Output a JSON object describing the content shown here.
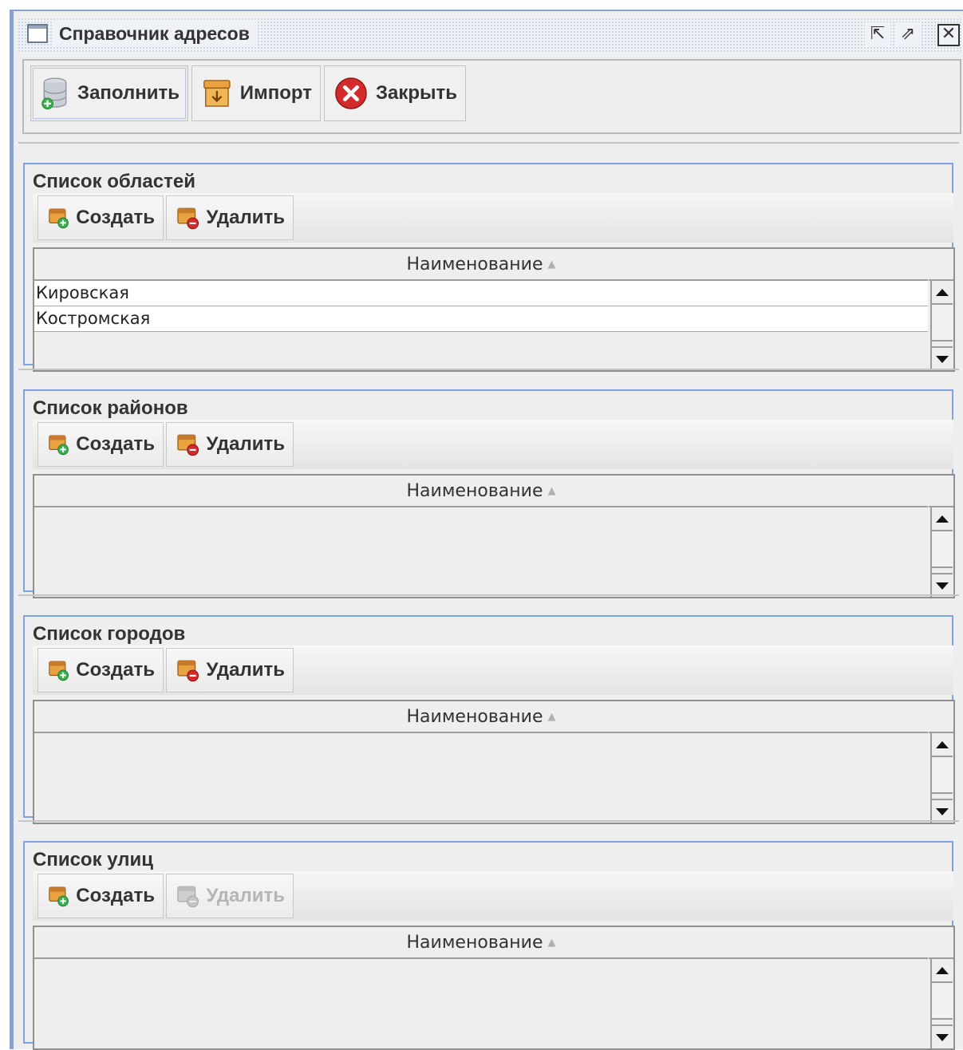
{
  "window": {
    "title": "Справочник адресов",
    "controls": {
      "minimize": "⇱",
      "maximize": "⇗",
      "close": "✕"
    }
  },
  "toolbar": {
    "fill_label": "Заполнить",
    "import_label": "Импорт",
    "close_label": "Закрыть"
  },
  "sections": {
    "regions": {
      "title": "Список областей",
      "create_label": "Создать",
      "delete_label": "Удалить",
      "column": "Наименование",
      "rows": [
        "Кировская",
        "Костромская"
      ]
    },
    "districts": {
      "title": "Список районов",
      "create_label": "Создать",
      "delete_label": "Удалить",
      "column": "Наименование",
      "rows": []
    },
    "cities": {
      "title": "Список городов",
      "create_label": "Создать",
      "delete_label": "Удалить",
      "column": "Наименование",
      "rows": []
    },
    "streets": {
      "title": "Список улиц",
      "create_label": "Создать",
      "delete_label": "Удалить",
      "delete_disabled": true,
      "column": "Наименование",
      "rows": []
    }
  },
  "icons": {
    "fill": "database-add-icon",
    "import": "archive-box-icon",
    "close": "red-x-circle-icon",
    "create": "record-add-icon",
    "delete": "record-delete-icon"
  },
  "colors": {
    "window_border": "#8aa2c9",
    "group_border": "#7fa2e0",
    "background": "#eeeeee",
    "close_red": "#d32b2b",
    "add_green": "#37b24d"
  }
}
